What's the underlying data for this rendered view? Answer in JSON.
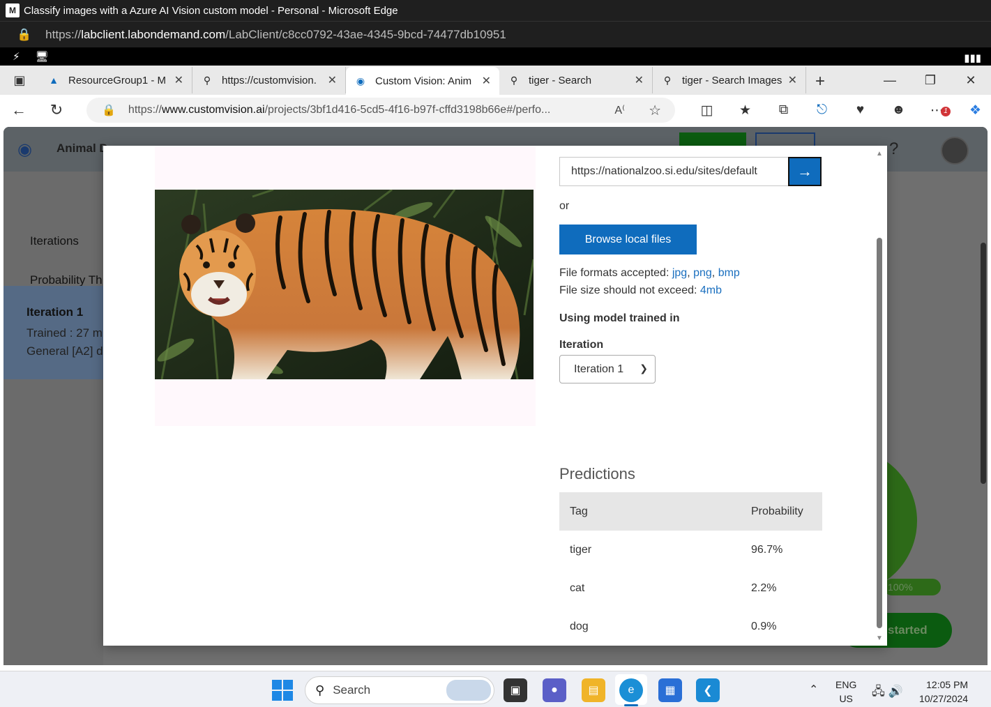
{
  "outer_window": {
    "title": "Classify images with a Azure AI Vision custom model - Personal - Microsoft Edge",
    "url_prefix": "https://",
    "url_host": "labclient.labondemand.com",
    "url_path": "/LabClient/c8cc0792-43ae-4345-9bcd-74477db10951"
  },
  "tabs": [
    {
      "label": "ResourceGroup1 - M",
      "icon": "azure-icon"
    },
    {
      "label": "https://customvision.",
      "icon": "search-icon"
    },
    {
      "label": "Custom Vision: Anim",
      "icon": "custom-vision-icon",
      "active": true
    },
    {
      "label": "tiger - Search",
      "icon": "search-icon"
    },
    {
      "label": "tiger - Search Images",
      "icon": "search-icon"
    }
  ],
  "address": {
    "prefix": "https://",
    "host": "www.customvision.ai",
    "path": "/projects/3bf1d416-5cd5-4f16-b97f-cffd3198b66e#/perfo..."
  },
  "background_page": {
    "project_name": "Animal D",
    "sidebar_iterations": "Iterations",
    "sidebar_probability": "Probability Th",
    "iteration_card": {
      "name": "Iteration 1",
      "trained": "Trained : 27 m",
      "domain": "General [A2] d"
    },
    "progress_label": "100%",
    "get_started_label": "started"
  },
  "modal": {
    "url_value": "https://nationalzoo.si.edu/sites/default",
    "or_text": "or",
    "browse_label": "Browse local files",
    "formats_prefix": "File formats accepted: ",
    "formats": [
      "jpg",
      "png",
      "bmp"
    ],
    "size_prefix": "File size should not exceed: ",
    "size_limit": "4mb",
    "using_model_label": "Using model trained in",
    "iteration_label": "Iteration",
    "iteration_selected": "Iteration 1",
    "predictions_title": "Predictions",
    "table_headers": {
      "tag": "Tag",
      "probability": "Probability"
    },
    "predictions": [
      {
        "tag": "tiger",
        "probability": "96.7%"
      },
      {
        "tag": "cat",
        "probability": "2.2%"
      },
      {
        "tag": "dog",
        "probability": "0.9%"
      }
    ]
  },
  "taskbar": {
    "search_placeholder": "Search",
    "lang_top": "ENG",
    "lang_bottom": "US",
    "time": "12:05 PM",
    "date": "10/27/2024"
  },
  "colors": {
    "accent_blue": "#0f6cbd",
    "link_blue": "#1a6fbf",
    "cv_green": "#0b5b10"
  }
}
